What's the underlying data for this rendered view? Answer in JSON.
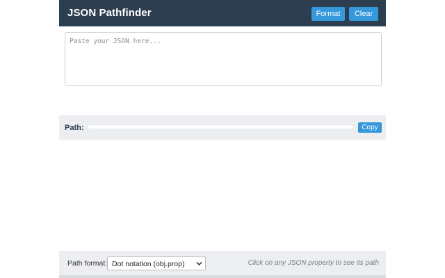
{
  "header": {
    "title": "JSON Pathfinder",
    "format_label": "Format",
    "clear_label": "Clear"
  },
  "input": {
    "placeholder": "Paste your JSON here...",
    "value": ""
  },
  "path_bar": {
    "label": "Path:",
    "value": "",
    "copy_label": "Copy"
  },
  "footer": {
    "format_label": "Path format:",
    "selected_format": "Dot notation (obj.prop)",
    "hint": "Click on any JSON property to see its path"
  },
  "colors": {
    "header_bg": "#2c3e50",
    "accent": "#3498db",
    "bar_bg": "#eceef1"
  },
  "icons": {
    "select_arrow": "chevron-down-icon"
  }
}
